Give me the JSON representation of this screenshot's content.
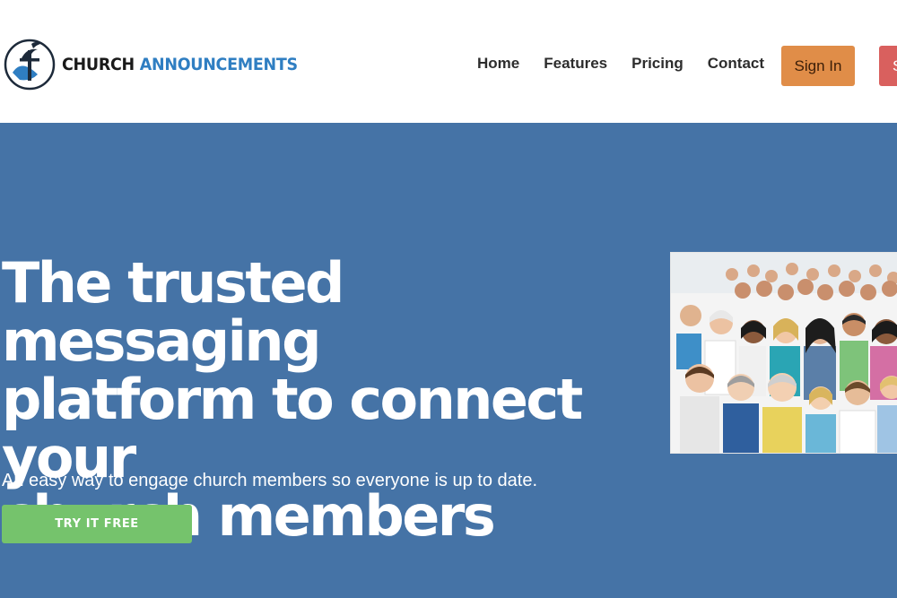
{
  "header": {
    "logo_icon": "cross-church-icon",
    "logo_word1": "CHURCH",
    "logo_word2": "ANNOUNCEMENTS",
    "nav": [
      "Home",
      "Features",
      "Pricing",
      "Contact"
    ],
    "signin_label": "Sign In",
    "signup_label": "S"
  },
  "hero": {
    "headline_lines": [
      "The trusted messaging",
      "platform to connect your",
      "church members"
    ],
    "subtitle": "An easy way to engage church members so everyone is up to date.",
    "cta_label": "TRY IT FREE",
    "image_icon": "crowd-photo"
  },
  "colors": {
    "brand_blue": "#2f7ec2",
    "hero_bg": "#4573a6",
    "signin_bg": "#e08d48",
    "signup_bg": "#d9605e",
    "cta_bg": "#75c36c"
  }
}
